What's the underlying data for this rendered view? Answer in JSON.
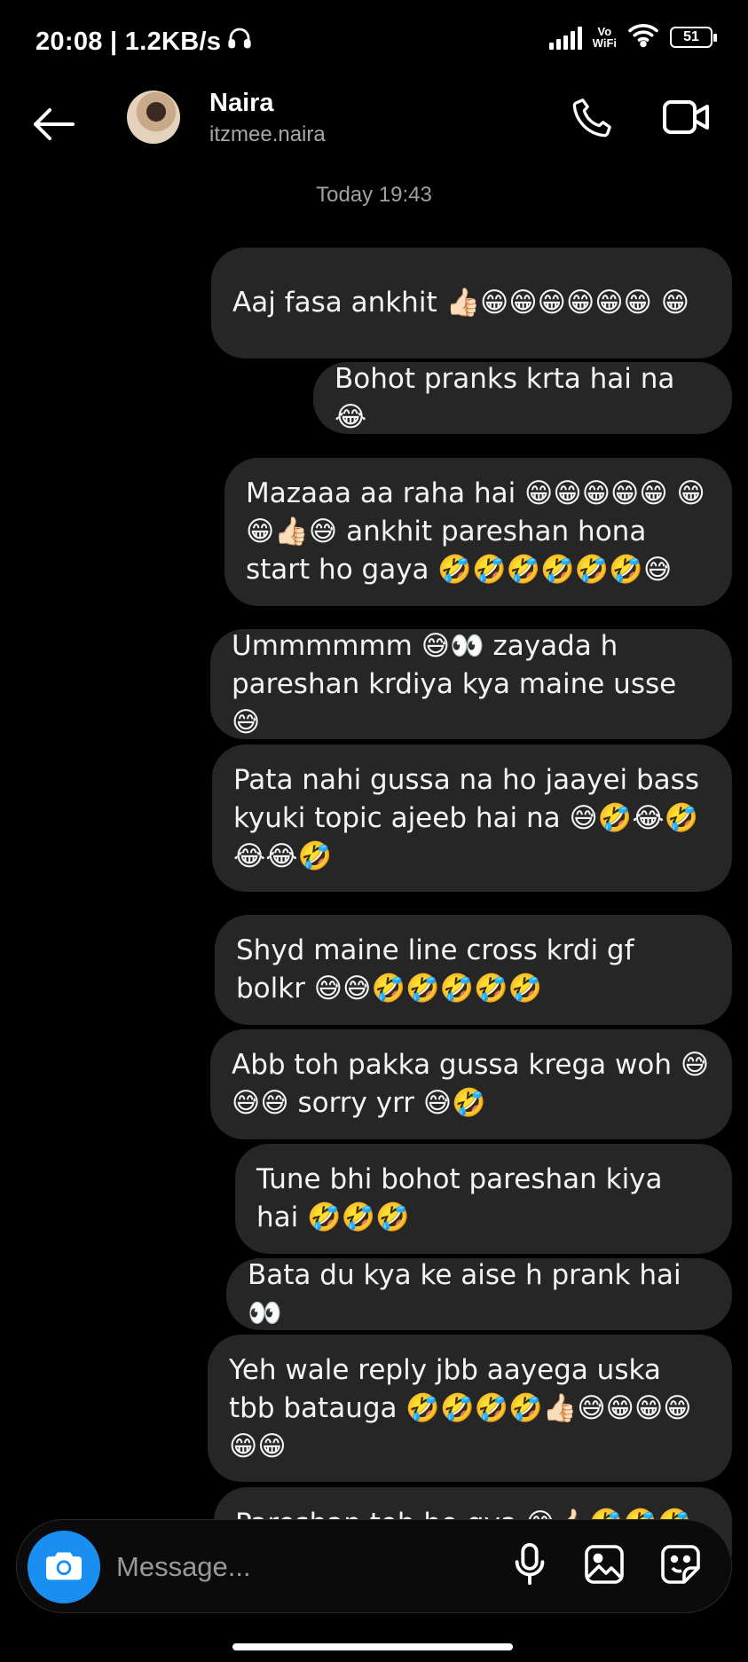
{
  "status_bar": {
    "time_network": "20:08 | 1.2KB/s",
    "vowifi_top": "Vo",
    "vowifi_bottom": "WiFi",
    "battery": "51"
  },
  "header": {
    "name": "Naira",
    "handle": "itzmee.naira"
  },
  "thread": {
    "timestamp": "Today 19:43",
    "messages": [
      "Aaj fasa ankhit 👍🏻😁😁😁😁😁😁 😁",
      "Bohot pranks krta hai na 😂",
      "Mazaaa aa raha hai 😁😁😁😁😁 😁😁👍🏻😅 ankhit pareshan hona start ho gaya 🤣🤣🤣🤣🤣🤣😅",
      "Ummmmmm 😅👀 zayada h pareshan krdiya kya maine usse 😅",
      "Pata nahi gussa na ho jaayei bass kyuki topic ajeeb hai na 😅🤣😂🤣 😂😂🤣",
      "Shyd maine line cross krdi gf bolkr 😅😅🤣🤣🤣🤣🤣",
      "Abb toh pakka gussa krega woh 😅 😅😅 sorry yrr 😅🤣",
      "Tune bhi bohot pareshan kiya hai 🤣🤣🤣",
      "Bata du kya ke aise h prank hai 👀",
      "Yeh wale reply jbb aayega uska tbb bataugа 🤣🤣🤣🤣👍🏻😅😁😁😁 😁😁",
      "Pareshan toh ho gya 😅👍🏻🤣🤣🤣"
    ]
  },
  "composer": {
    "placeholder": "Message..."
  },
  "icons": {
    "back": "arrow-left-icon",
    "call": "phone-icon",
    "video": "video-camera-icon",
    "camera": "camera-icon",
    "mic": "microphone-icon",
    "gallery": "image-icon",
    "sticker": "sticker-icon"
  },
  "colors": {
    "background": "#000000",
    "bubble": "#262626",
    "accent": "#1a8ff2",
    "secondary_text": "#a8a8a8"
  }
}
